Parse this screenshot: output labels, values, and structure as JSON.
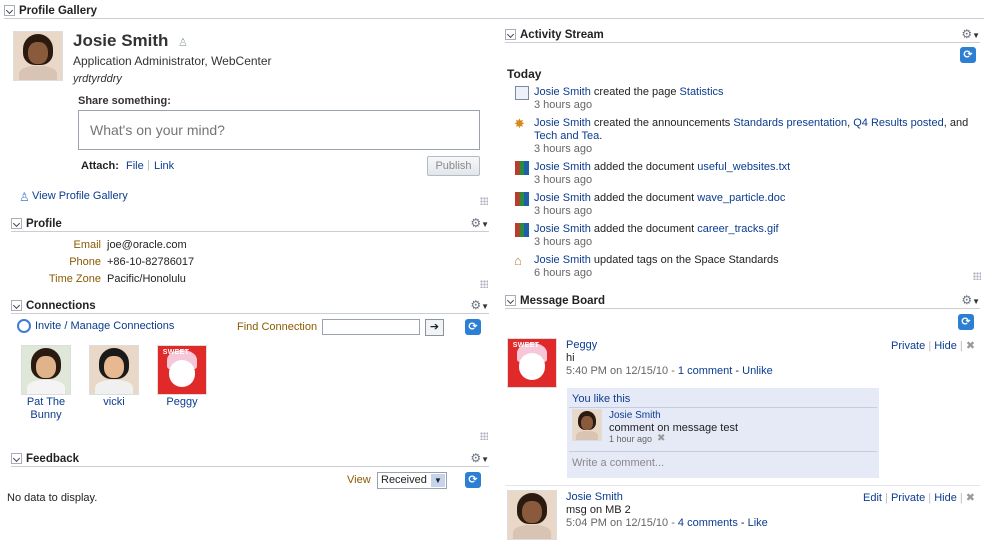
{
  "gallery": {
    "title": "Profile Gallery"
  },
  "user": {
    "name": "Josie Smith",
    "title": "Application Administrator, WebCenter",
    "status": "yrdtyrddry",
    "share_label": "Share something:",
    "share_placeholder": "What's on your mind?",
    "attach_label": "Attach:",
    "attach_file": "File",
    "attach_link": "Link",
    "publish": "Publish",
    "view_gallery": "View Profile Gallery"
  },
  "profile": {
    "title": "Profile",
    "fields": [
      {
        "label": "Email",
        "value": "joe@oracle.com"
      },
      {
        "label": "Phone",
        "value": "+86-10-82786017"
      },
      {
        "label": "Time Zone",
        "value": "Pacific/Honolulu"
      }
    ]
  },
  "connections": {
    "title": "Connections",
    "invite": "Invite / Manage Connections",
    "find_label": "Find Connection",
    "people": [
      {
        "name": "Pat The Bunny"
      },
      {
        "name": "vicki"
      },
      {
        "name": "Peggy"
      }
    ]
  },
  "feedback": {
    "title": "Feedback",
    "view_label": "View",
    "view_value": "Received",
    "empty": "No data to display."
  },
  "activity": {
    "title": "Activity Stream",
    "today": "Today",
    "items": [
      {
        "icon": "page-icon",
        "actor": "Josie Smith",
        "text": " created the page ",
        "target": "Statistics",
        "time": "3 hours ago"
      },
      {
        "icon": "announcement-icon",
        "actor": "Josie Smith",
        "text": " created the announcements ",
        "target": "Standards presentation",
        "sep1": ", ",
        "target2": "Q4 Results posted",
        "sep2": ", and",
        "target3": "Tech and Tea",
        "end": ".",
        "time": "3 hours ago"
      },
      {
        "icon": "document-icon",
        "actor": "Josie Smith",
        "text": " added the document ",
        "target": "useful_websites.txt",
        "time": "3 hours ago"
      },
      {
        "icon": "document-icon",
        "actor": "Josie Smith",
        "text": " added the document ",
        "target": "wave_particle.doc",
        "time": "3 hours ago"
      },
      {
        "icon": "document-icon",
        "actor": "Josie Smith",
        "text": " added the document ",
        "target": "career_tracks.gif",
        "time": "3 hours ago"
      },
      {
        "icon": "tag-icon",
        "actor": "Josie Smith",
        "text": " updated tags on the Space Standards",
        "target": "",
        "time": "6 hours ago"
      }
    ]
  },
  "board": {
    "title": "Message Board",
    "messages": [
      {
        "author": "Peggy",
        "body": "hi",
        "time": "5:40 PM on 12/15/10 - ",
        "comments": "1 comment",
        "dash": " - ",
        "like": "Unlike",
        "actions": [
          "Private",
          "Hide"
        ],
        "you_like": "You like this",
        "comment": {
          "author": "Josie Smith",
          "body": "comment on message test",
          "time": "1 hour ago"
        },
        "write_placeholder": "Write a comment..."
      },
      {
        "author": "Josie Smith",
        "body": "msg on MB 2",
        "time": "5:04 PM on 12/15/10 - ",
        "comments": "4 comments",
        "dash": " - ",
        "like": "Like",
        "actions": [
          "Edit",
          "Private",
          "Hide"
        ]
      }
    ]
  },
  "separator": "|",
  "close_glyph": "✖"
}
